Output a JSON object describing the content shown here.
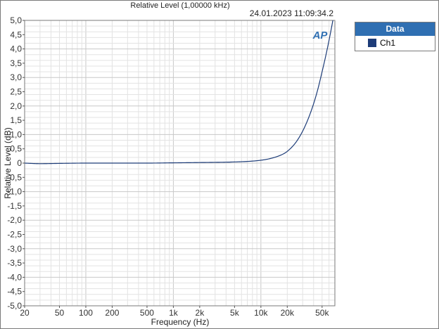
{
  "chart_data": {
    "type": "line",
    "title": "Relative Level (1,00000 kHz)",
    "timestamp": "24.01.2023 11:09:34.2",
    "logo_text": "AP",
    "xlabel": "Frequency (Hz)",
    "ylabel": "Relative Level (dB)",
    "x_scale": "log",
    "xlim": [
      20,
      70000
    ],
    "ylim": [
      -5.0,
      5.0
    ],
    "grid": true,
    "x_ticks": [
      {
        "value": 20,
        "label": "20"
      },
      {
        "value": 50,
        "label": "50"
      },
      {
        "value": 100,
        "label": "100"
      },
      {
        "value": 200,
        "label": "200"
      },
      {
        "value": 500,
        "label": "500"
      },
      {
        "value": 1000,
        "label": "1k"
      },
      {
        "value": 2000,
        "label": "2k"
      },
      {
        "value": 5000,
        "label": "5k"
      },
      {
        "value": 10000,
        "label": "10k"
      },
      {
        "value": 20000,
        "label": "20k"
      },
      {
        "value": 50000,
        "label": "50k"
      }
    ],
    "y_ticks": [
      {
        "value": 5.0,
        "label": "5,0"
      },
      {
        "value": 4.5,
        "label": "4,5"
      },
      {
        "value": 4.0,
        "label": "4,0"
      },
      {
        "value": 3.5,
        "label": "3,5"
      },
      {
        "value": 3.0,
        "label": "3,0"
      },
      {
        "value": 2.5,
        "label": "2,5"
      },
      {
        "value": 2.0,
        "label": "2,0"
      },
      {
        "value": 1.5,
        "label": "1,5"
      },
      {
        "value": 1.0,
        "label": "1,0"
      },
      {
        "value": 0.5,
        "label": "0,5"
      },
      {
        "value": 0.0,
        "label": "0"
      },
      {
        "value": -0.5,
        "label": "-0,5"
      },
      {
        "value": -1.0,
        "label": "-1,0"
      },
      {
        "value": -1.5,
        "label": "-1,5"
      },
      {
        "value": -2.0,
        "label": "-2,0"
      },
      {
        "value": -2.5,
        "label": "-2,5"
      },
      {
        "value": -3.0,
        "label": "-3,0"
      },
      {
        "value": -3.5,
        "label": "-3,5"
      },
      {
        "value": -4.0,
        "label": "-4,0"
      },
      {
        "value": -4.5,
        "label": "-4,5"
      },
      {
        "value": -5.0,
        "label": "-5,0"
      }
    ],
    "series": [
      {
        "name": "Ch1",
        "color": "#1d3c78",
        "x": [
          20,
          30,
          50,
          100,
          200,
          500,
          1000,
          2000,
          5000,
          8000,
          10000,
          12000,
          15000,
          18000,
          20000,
          25000,
          30000,
          35000,
          40000,
          45000,
          50000,
          55000,
          60000,
          65000,
          70000
        ],
        "y": [
          0.0,
          -0.02,
          -0.01,
          0.0,
          0.0,
          0.0,
          0.01,
          0.02,
          0.04,
          0.07,
          0.1,
          0.14,
          0.22,
          0.32,
          0.41,
          0.72,
          1.12,
          1.58,
          2.08,
          2.62,
          3.2,
          3.75,
          4.3,
          4.85,
          5.4
        ]
      }
    ],
    "legend": {
      "title": "Data",
      "placement": "right",
      "entries": [
        "Ch1"
      ]
    }
  }
}
